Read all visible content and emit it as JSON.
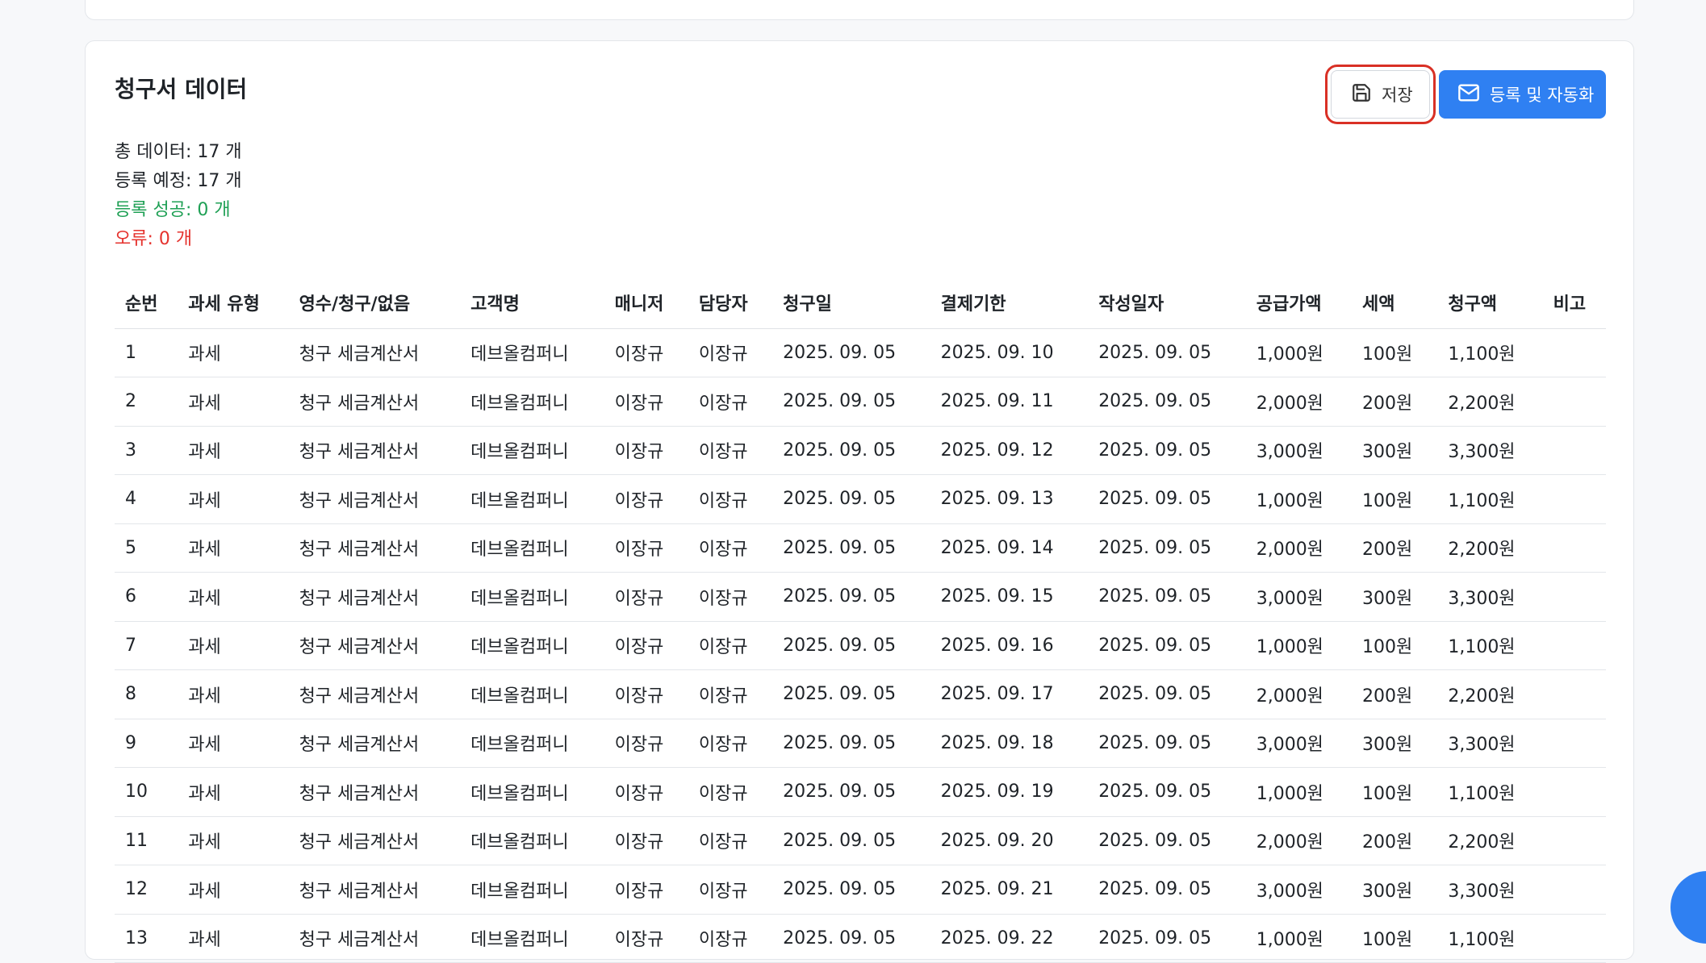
{
  "section": {
    "title": "청구서 데이터"
  },
  "buttons": {
    "save_label": "저장",
    "register_label": "등록 및 자동화"
  },
  "stats": {
    "total": "총 데이터: 17 개",
    "pending": "등록 예정: 17 개",
    "success": "등록 성공: 0 개",
    "error": "오류: 0 개"
  },
  "colors": {
    "primary": "#2f80f2",
    "success": "#1fa055",
    "error": "#e5322d",
    "highlight": "#d93025"
  },
  "table": {
    "headers": [
      "순번",
      "과세 유형",
      "영수/청구/없음",
      "고객명",
      "매니저",
      "담당자",
      "청구일",
      "결제기한",
      "작성일자",
      "공급가액",
      "세액",
      "청구액",
      "비고"
    ],
    "rows": [
      [
        "1",
        "과세",
        "청구 세금계산서",
        "데브올컴퍼니",
        "이장규",
        "이장규",
        "2025. 09. 05",
        "2025. 09. 10",
        "2025. 09. 05",
        "1,000원",
        "100원",
        "1,100원",
        ""
      ],
      [
        "2",
        "과세",
        "청구 세금계산서",
        "데브올컴퍼니",
        "이장규",
        "이장규",
        "2025. 09. 05",
        "2025. 09. 11",
        "2025. 09. 05",
        "2,000원",
        "200원",
        "2,200원",
        ""
      ],
      [
        "3",
        "과세",
        "청구 세금계산서",
        "데브올컴퍼니",
        "이장규",
        "이장규",
        "2025. 09. 05",
        "2025. 09. 12",
        "2025. 09. 05",
        "3,000원",
        "300원",
        "3,300원",
        ""
      ],
      [
        "4",
        "과세",
        "청구 세금계산서",
        "데브올컴퍼니",
        "이장규",
        "이장규",
        "2025. 09. 05",
        "2025. 09. 13",
        "2025. 09. 05",
        "1,000원",
        "100원",
        "1,100원",
        ""
      ],
      [
        "5",
        "과세",
        "청구 세금계산서",
        "데브올컴퍼니",
        "이장규",
        "이장규",
        "2025. 09. 05",
        "2025. 09. 14",
        "2025. 09. 05",
        "2,000원",
        "200원",
        "2,200원",
        ""
      ],
      [
        "6",
        "과세",
        "청구 세금계산서",
        "데브올컴퍼니",
        "이장규",
        "이장규",
        "2025. 09. 05",
        "2025. 09. 15",
        "2025. 09. 05",
        "3,000원",
        "300원",
        "3,300원",
        ""
      ],
      [
        "7",
        "과세",
        "청구 세금계산서",
        "데브올컴퍼니",
        "이장규",
        "이장규",
        "2025. 09. 05",
        "2025. 09. 16",
        "2025. 09. 05",
        "1,000원",
        "100원",
        "1,100원",
        ""
      ],
      [
        "8",
        "과세",
        "청구 세금계산서",
        "데브올컴퍼니",
        "이장규",
        "이장규",
        "2025. 09. 05",
        "2025. 09. 17",
        "2025. 09. 05",
        "2,000원",
        "200원",
        "2,200원",
        ""
      ],
      [
        "9",
        "과세",
        "청구 세금계산서",
        "데브올컴퍼니",
        "이장규",
        "이장규",
        "2025. 09. 05",
        "2025. 09. 18",
        "2025. 09. 05",
        "3,000원",
        "300원",
        "3,300원",
        ""
      ],
      [
        "10",
        "과세",
        "청구 세금계산서",
        "데브올컴퍼니",
        "이장규",
        "이장규",
        "2025. 09. 05",
        "2025. 09. 19",
        "2025. 09. 05",
        "1,000원",
        "100원",
        "1,100원",
        ""
      ],
      [
        "11",
        "과세",
        "청구 세금계산서",
        "데브올컴퍼니",
        "이장규",
        "이장규",
        "2025. 09. 05",
        "2025. 09. 20",
        "2025. 09. 05",
        "2,000원",
        "200원",
        "2,200원",
        ""
      ],
      [
        "12",
        "과세",
        "청구 세금계산서",
        "데브올컴퍼니",
        "이장규",
        "이장규",
        "2025. 09. 05",
        "2025. 09. 21",
        "2025. 09. 05",
        "3,000원",
        "300원",
        "3,300원",
        ""
      ],
      [
        "13",
        "과세",
        "청구 세금계산서",
        "데브올컴퍼니",
        "이장규",
        "이장규",
        "2025. 09. 05",
        "2025. 09. 22",
        "2025. 09. 05",
        "1,000원",
        "100원",
        "1,100원",
        ""
      ]
    ]
  },
  "icons": {
    "save": "save-icon",
    "register": "mail-icon",
    "chat": "chat-icon"
  }
}
